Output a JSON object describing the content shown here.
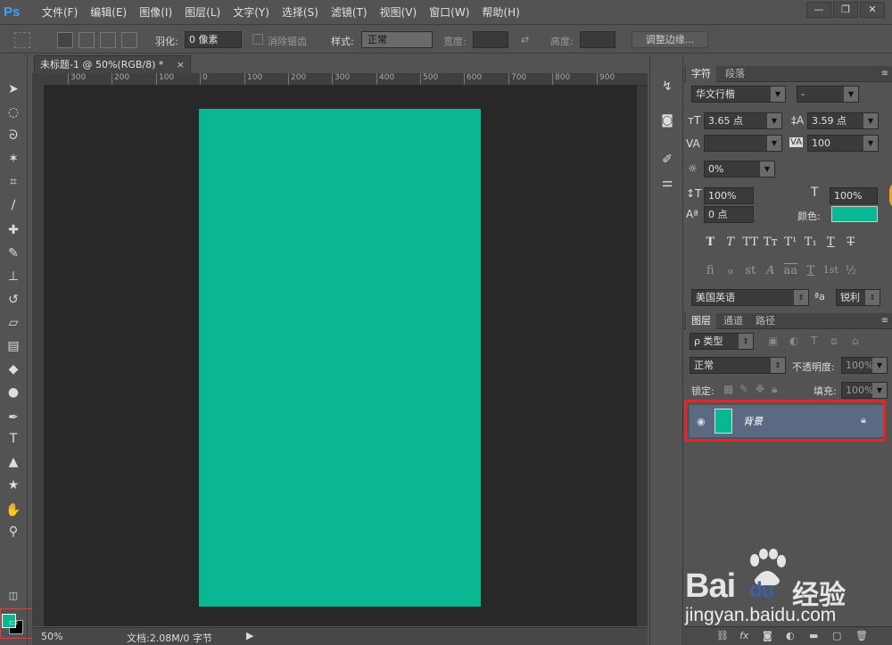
{
  "app": {
    "logo": "Ps"
  },
  "menu": [
    "文件(F)",
    "编辑(E)",
    "图像(I)",
    "图层(L)",
    "文字(Y)",
    "选择(S)",
    "滤镜(T)",
    "视图(V)",
    "窗口(W)",
    "帮助(H)"
  ],
  "window_buttons": [
    "—",
    "❐",
    "✕"
  ],
  "options": {
    "feather_label": "羽化:",
    "feather_value": "0 像素",
    "antialias_label": "消除锯齿",
    "style_label": "样式:",
    "style_value": "正常",
    "width_label": "宽度:",
    "height_label": "高度:",
    "refine_edge": "调整边缘..."
  },
  "document": {
    "tab_title": "未标题-1 @ 50%(RGB/8) *",
    "close": "×",
    "canvas_color": "#09b893"
  },
  "ruler_ticks": [
    "300",
    "200",
    "100",
    "0",
    "100",
    "200",
    "300",
    "400",
    "500",
    "600",
    "700",
    "800",
    "900"
  ],
  "status": {
    "zoom": "50%",
    "doc_info": "文档:2.08M/0 字节"
  },
  "character_panel": {
    "tabs": [
      "字符",
      "段落"
    ],
    "font_family": "华文行楷",
    "font_style": "-",
    "font_size": "3.65 点",
    "leading": "3.59 点",
    "kerning": "",
    "tracking": "100",
    "tsume": "0%",
    "vertical_scale": "100%",
    "horizontal_scale": "100%",
    "baseline_shift": "0 点",
    "color_label": "颜色:",
    "color_value": "#09b893",
    "style_glyphs": [
      "T",
      "T",
      "TT",
      "Tт",
      "T¹",
      "T₁",
      "T",
      "T"
    ],
    "ot_glyphs": [
      "fi",
      "ℴ",
      "st",
      "A",
      "aa",
      "T",
      "1st",
      "½"
    ],
    "language": "美国英语",
    "aa_label": "ªa",
    "antialias": "锐利"
  },
  "layers_panel": {
    "tabs": [
      "图层",
      "通道",
      "路径"
    ],
    "filter_kind": "ρ 类型",
    "blend_mode": "正常",
    "opacity_label": "不透明度:",
    "opacity_value": "100%",
    "lock_label": "锁定:",
    "fill_label": "填充:",
    "fill_value": "100%",
    "layers": [
      {
        "name": "背景",
        "visible": true,
        "locked": true,
        "color": "#09b893"
      }
    ]
  },
  "watermark": {
    "brand": "Bai",
    "brand2": "du",
    "product": "经验",
    "url": "jingyan.baidu.com"
  }
}
